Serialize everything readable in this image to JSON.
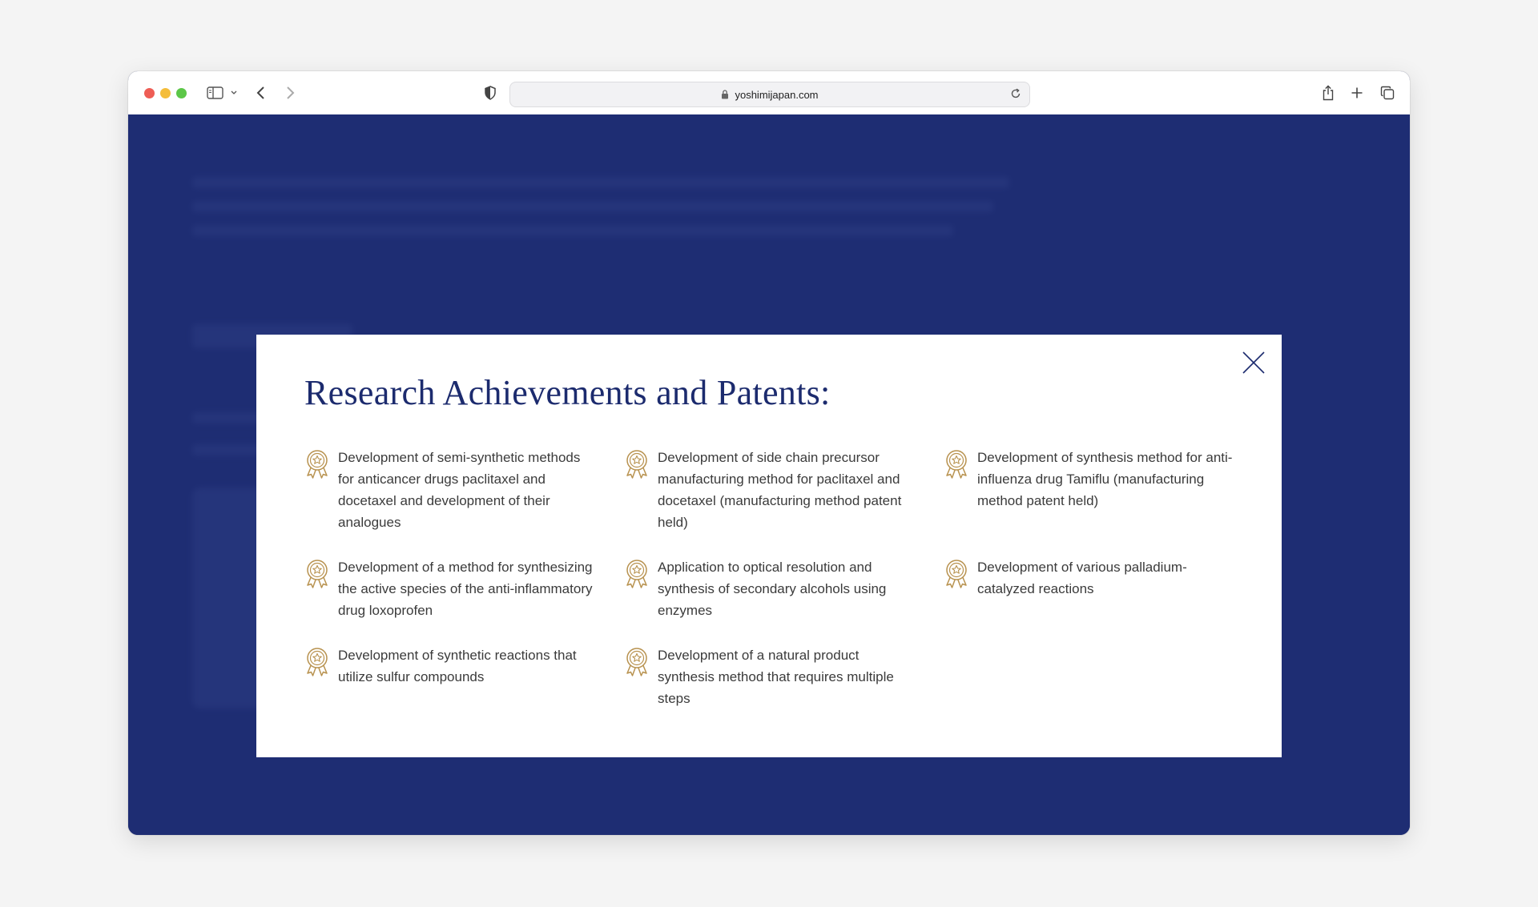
{
  "browser": {
    "url": "yoshimijapan.com",
    "icons": {
      "sidebar": "sidebar-icon",
      "back": "chevron-left-icon",
      "forward": "chevron-right-icon",
      "privacy": "shield-icon",
      "lock": "lock-icon",
      "reload": "reload-icon",
      "share": "share-icon",
      "new_tab": "plus-icon",
      "tabs": "tabs-overview-icon"
    }
  },
  "modal": {
    "title": "Research Achievements and Patents:",
    "close_icon": "close-icon",
    "item_icon": "award-medal-icon",
    "items": [
      "Development of semi-synthetic methods for anticancer drugs paclitaxel and docetaxel and development of their analogues",
      "Development of side chain precursor manufacturing method for paclitaxel and docetaxel (manufacturing method patent held)",
      "Development of synthesis method for anti-influenza drug Tamiflu (manufacturing method patent held)",
      "Development of a method for synthesizing the active species of the anti-inflammatory drug loxoprofen",
      "Application to optical resolution and synthesis of secondary alcohols using enzymes",
      "Development of various palladium-catalyzed reactions",
      "Development of synthetic reactions that utilize sulfur compounds",
      "Development of a natural product synthesis method that requires multiple steps"
    ]
  },
  "colors": {
    "page_background": "#1e2d73",
    "title": "#1c2b6e",
    "icon_gold": "#b8924f",
    "body_text": "#3b3b3b"
  }
}
